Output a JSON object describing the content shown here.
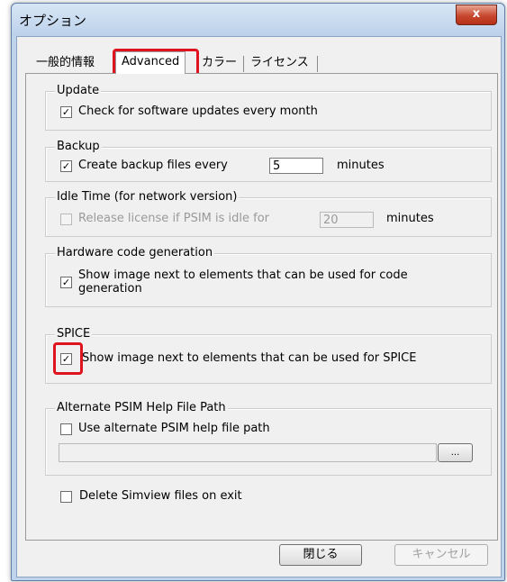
{
  "window": {
    "title": "オプション",
    "close_label": "x"
  },
  "tabs": [
    {
      "label": "一般的情報"
    },
    {
      "label": "Advanced"
    },
    {
      "label": "カラー"
    },
    {
      "label": "ライセンス"
    }
  ],
  "groups": {
    "update": {
      "legend": "Update",
      "checkbox_label": "Check for software updates every month",
      "checked": true
    },
    "backup": {
      "legend": "Backup",
      "checkbox_label": "Create backup files every",
      "value": "5",
      "unit": "minutes",
      "checked": true
    },
    "idle": {
      "legend": "Idle Time (for network version)",
      "checkbox_label": "Release license if PSIM is idle for",
      "value": "20",
      "unit": "minutes",
      "checked": false,
      "disabled": true
    },
    "hardware": {
      "legend": "Hardware code generation",
      "checkbox_label_line1": "Show image next to elements that can be used for code",
      "checkbox_label_line2": "generation",
      "checked": true
    },
    "spice": {
      "legend": "SPICE",
      "checkbox_label": "Show image next to elements that can be used for SPICE",
      "checked": true
    },
    "helpfile": {
      "legend": "Alternate PSIM Help File Path",
      "checkbox_label": "Use alternate PSIM help file path",
      "path_value": "",
      "browse_label": "...",
      "checked": false
    }
  },
  "delete_simview": {
    "label": "Delete Simview files on exit",
    "checked": false
  },
  "buttons": {
    "close": "閉じる",
    "cancel": "キャンセル"
  },
  "check_mark": "✓",
  "colors": {
    "highlight": "#e0141e",
    "title_bar": "#bfd3ea",
    "close_button": "#c7482e"
  }
}
